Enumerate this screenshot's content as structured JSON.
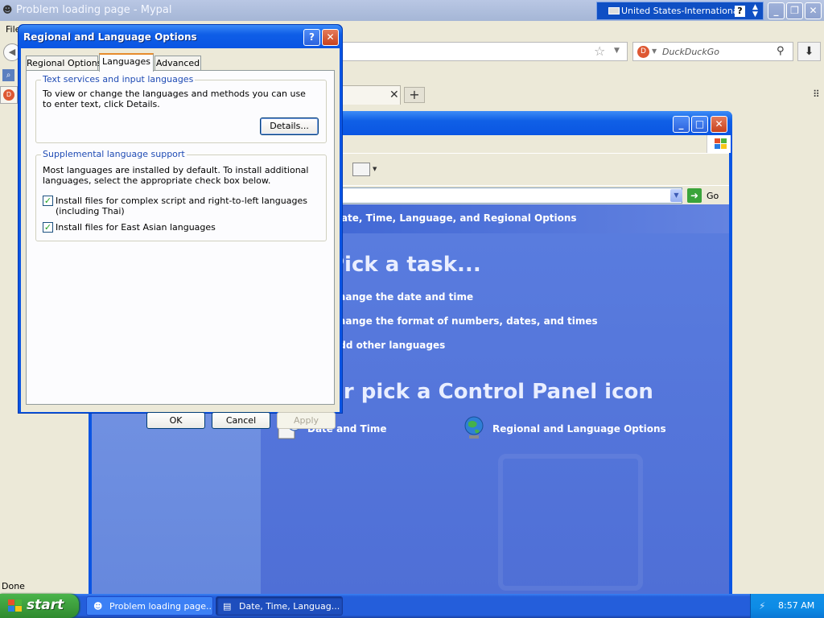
{
  "browser": {
    "title": "Problem loading page - Mypal",
    "menu": {
      "file": "File"
    },
    "search": {
      "placeholder": "DuckDuckGo"
    },
    "status": "Done"
  },
  "language_bar": {
    "language": "United States-International",
    "help": "?"
  },
  "control_panel": {
    "address": {
      "go_label": "Go"
    },
    "header": "Date, Time, Language, and Regional Options",
    "pick_task": "Pick a task...",
    "tasks": [
      "Change the date and time",
      "Change the format of numbers, dates, and times",
      "Add other languages"
    ],
    "pick_icon": "or pick a Control Panel icon",
    "items": [
      {
        "label": "Date and Time"
      },
      {
        "label": "Regional and Language Options"
      }
    ]
  },
  "dialog": {
    "title": "Regional and Language Options",
    "tabs": [
      "Regional Options",
      "Languages",
      "Advanced"
    ],
    "active_tab": "Languages",
    "text_services": {
      "title": "Text services and input languages",
      "description": "To view or change the languages and methods you can use to enter text, click Details.",
      "details_button": "Details..."
    },
    "supplemental": {
      "title": "Supplemental language support",
      "description": "Most languages are installed by default. To install additional languages, select the appropriate check box below.",
      "checkbox_complex": "Install files for complex script and right-to-left languages (including Thai)",
      "checkbox_complex_checked": true,
      "checkbox_east_asian": "Install files for East Asian languages",
      "checkbox_east_asian_checked": true
    },
    "buttons": {
      "ok": "OK",
      "cancel": "Cancel",
      "apply": "Apply"
    }
  },
  "taskbar": {
    "start": "start",
    "tasks": [
      {
        "label": "Problem loading page..."
      },
      {
        "label": "Date, Time, Languag..."
      }
    ],
    "clock": "8:57 AM"
  },
  "colors": {
    "xp_blue": "#0a55e3",
    "start_green": "#3b9b3b",
    "cp_background": "#5a7ddf"
  }
}
